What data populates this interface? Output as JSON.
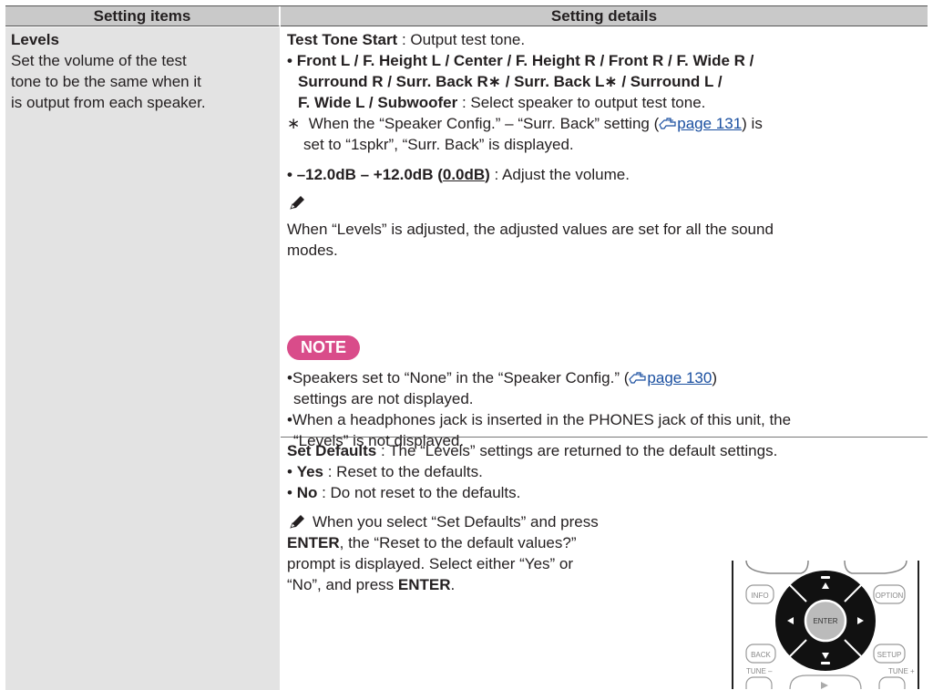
{
  "header": {
    "col1": "Setting items",
    "col2": "Setting details"
  },
  "levels": {
    "title": "Levels",
    "desc_lines": [
      "Set the volume of the test",
      "tone to be the same when it",
      "is output from each speaker."
    ]
  },
  "test_tone": {
    "label": "Test Tone Start",
    "text": " : Output test tone."
  },
  "speakers": {
    "line1": "Front L / F. Height L / Center / F. Height R / Front R / F. Wide R /",
    "line2": "Surround R / Surr. Back R∗ / Surr. Back L∗ / Surround L /",
    "line3_bold": "F. Wide L / Subwoofer",
    "line3_text": " : Select speaker to output test tone."
  },
  "footnote": {
    "mark": "∗",
    "line1_a": "When the “Speaker Config.” – “Surr. Back” setting (",
    "line1_link": "page 131",
    "line1_b": ") is",
    "line2": "set to “1spkr”, “Surr. Back” is displayed."
  },
  "range": {
    "bold": "–12.0dB – +12.0dB (",
    "default": "0.0dB",
    "close": ")",
    "text": " : Adjust the volume."
  },
  "tip": {
    "line1": "When “Levels” is adjusted, the adjusted values are set for all the sound",
    "line2": "modes."
  },
  "note": {
    "badge": "NOTE",
    "item1_a": "Speakers set to “None” in the “Speaker Config.” (",
    "item1_link": "page 130",
    "item1_b": ")",
    "item1_line2": "settings are not displayed.",
    "item2_line1": "When a headphones jack is inserted in the PHONES jack of this unit, the",
    "item2_line2": "“Levels” is not displayed."
  },
  "set_defaults": {
    "label": "Set Defaults",
    "text": " : The “Levels” settings are returned to the default settings.",
    "yes_label": "Yes",
    "yes_text": " : Reset to the defaults.",
    "no_label": "No",
    "no_text": " : Do not reset to the defaults."
  },
  "defaults_tip": {
    "line1": "When you select “Set Defaults” and press",
    "line2_bold": "ENTER",
    "line2_text": ", the “Reset to the default values?”",
    "line3": "prompt is displayed. Select either “Yes” or",
    "line4_a": "“No”, and press ",
    "line4_bold": "ENTER",
    "line4_b": "."
  },
  "remote": {
    "info": "INFO",
    "option": "OPTION",
    "enter": "ENTER",
    "back": "BACK",
    "setup": "SETUP",
    "tune_minus": "TUNE –",
    "tune_plus": "TUNE +"
  },
  "icons": {
    "pencil": "pencil-icon",
    "page_ref": "page-reference-icon"
  },
  "colors": {
    "header_bg": "#c9c9c9",
    "left_col_bg": "#e3e3e3",
    "note_badge": "#d94c8a",
    "link": "#1a4fa0"
  }
}
